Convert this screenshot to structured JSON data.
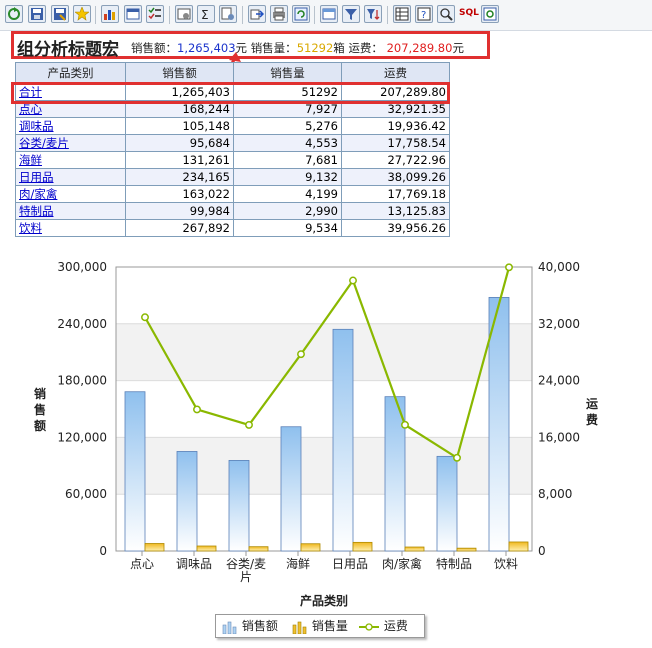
{
  "toolbar": {
    "buttons": [
      "refresh-icon",
      "save-icon",
      "save-as-icon",
      "favorite-icon",
      "chart-icon",
      "window-icon",
      "checklist-icon",
      "settings-icon",
      "sum-icon",
      "properties-icon",
      "export-icon",
      "print-icon",
      "reload-icon",
      "edit-report-icon",
      "filter-icon",
      "sort-filter-icon",
      "grid-icon",
      "help-icon",
      "query-icon",
      "sql-icon",
      "preview-icon"
    ],
    "sql_label": "SQL"
  },
  "header": {
    "title": "组分析标题宏",
    "sales_amount_label": "销售额：",
    "sales_amount_value": "1,265,403",
    "sales_amount_unit": "元",
    "sales_qty_label": "销售量：",
    "sales_qty_value": "51292",
    "sales_qty_unit": "箱",
    "freight_label": "运费：",
    "freight_value": "207,289.80",
    "freight_unit": "元"
  },
  "table": {
    "headers": [
      "产品类别",
      "销售额",
      "销售量",
      "运费"
    ],
    "rows": [
      {
        "cat": "合计",
        "amount": "1,265,403",
        "qty": "51292",
        "freight": "207,289.80"
      },
      {
        "cat": "点心",
        "amount": "168,244",
        "qty": "7,927",
        "freight": "32,921.35"
      },
      {
        "cat": "调味品",
        "amount": "105,148",
        "qty": "5,276",
        "freight": "19,936.42"
      },
      {
        "cat": "谷类/麦片",
        "amount": "95,684",
        "qty": "4,553",
        "freight": "17,758.54"
      },
      {
        "cat": "海鲜",
        "amount": "131,261",
        "qty": "7,681",
        "freight": "27,722.96"
      },
      {
        "cat": "日用品",
        "amount": "234,165",
        "qty": "9,132",
        "freight": "38,099.26"
      },
      {
        "cat": "肉/家禽",
        "amount": "163,022",
        "qty": "4,199",
        "freight": "17,769.18"
      },
      {
        "cat": "特制品",
        "amount": "99,984",
        "qty": "2,990",
        "freight": "13,125.83"
      },
      {
        "cat": "饮料",
        "amount": "267,892",
        "qty": "9,534",
        "freight": "39,956.26"
      }
    ]
  },
  "chart_data": {
    "type": "bar",
    "categories": [
      "点心",
      "调味品",
      "谷类/麦片",
      "海鲜",
      "日用品",
      "肉/家禽",
      "特制品",
      "饮料"
    ],
    "category_labels": [
      [
        "点心"
      ],
      [
        "调味品"
      ],
      [
        "谷类/麦",
        "片"
      ],
      [
        "海鲜"
      ],
      [
        "日用品"
      ],
      [
        "肉/家禽"
      ],
      [
        "特制品"
      ],
      [
        "饮料"
      ]
    ],
    "series": [
      {
        "name": "销售额",
        "type": "bar",
        "axis": "left",
        "values": [
          168244,
          105148,
          95684,
          131261,
          234165,
          163022,
          99984,
          267892
        ]
      },
      {
        "name": "销售量",
        "type": "bar",
        "axis": "left",
        "values": [
          7927,
          5276,
          4553,
          7681,
          9132,
          4199,
          2990,
          9534
        ]
      },
      {
        "name": "运费",
        "type": "line",
        "axis": "right",
        "values": [
          32921.35,
          19936.42,
          17758.54,
          27722.96,
          38099.26,
          17769.18,
          13125.83,
          39956.26
        ]
      }
    ],
    "xlabel": "产品类别",
    "ylabel": "销售额",
    "y2label": "运费",
    "ylim": [
      0,
      300000
    ],
    "y2lim": [
      0,
      40000
    ],
    "yticks": [
      "0",
      "60,000",
      "120,000",
      "180,000",
      "240,000",
      "300,000"
    ],
    "y2ticks": [
      "0",
      "8,000",
      "16,000",
      "24,000",
      "32,000",
      "40,000"
    ],
    "grid": "horizontal bands",
    "legend": "bottom-center",
    "colors": {
      "amount": "#aed3f3",
      "qty": "#f0c030",
      "freight": "#8ab800"
    }
  }
}
